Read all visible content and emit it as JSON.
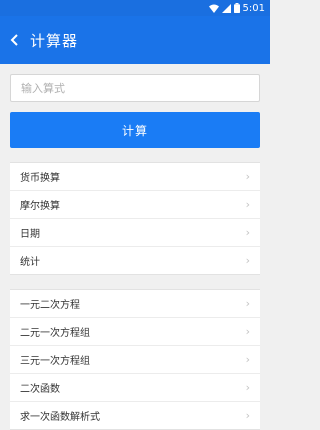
{
  "status_bar": {
    "time": "5:01",
    "icons": [
      "wifi-icon",
      "signal-icon",
      "battery-icon"
    ]
  },
  "app_bar": {
    "back_icon": "back-arrow-icon",
    "title": "计算器"
  },
  "input": {
    "placeholder": "输入算式",
    "value": ""
  },
  "calc_button": {
    "label": "计算"
  },
  "group1": [
    {
      "label": "货币换算"
    },
    {
      "label": "摩尔换算"
    },
    {
      "label": "日期"
    },
    {
      "label": "统计"
    }
  ],
  "group2": [
    {
      "label": "一元二次方程"
    },
    {
      "label": "二元一次方程组"
    },
    {
      "label": "三元一次方程组"
    },
    {
      "label": "二次函数"
    },
    {
      "label": "求一次函数解析式"
    }
  ],
  "colors": {
    "app_bar": "#1a73e8",
    "button": "#1a7cf5",
    "background": "#f0f0f0"
  }
}
